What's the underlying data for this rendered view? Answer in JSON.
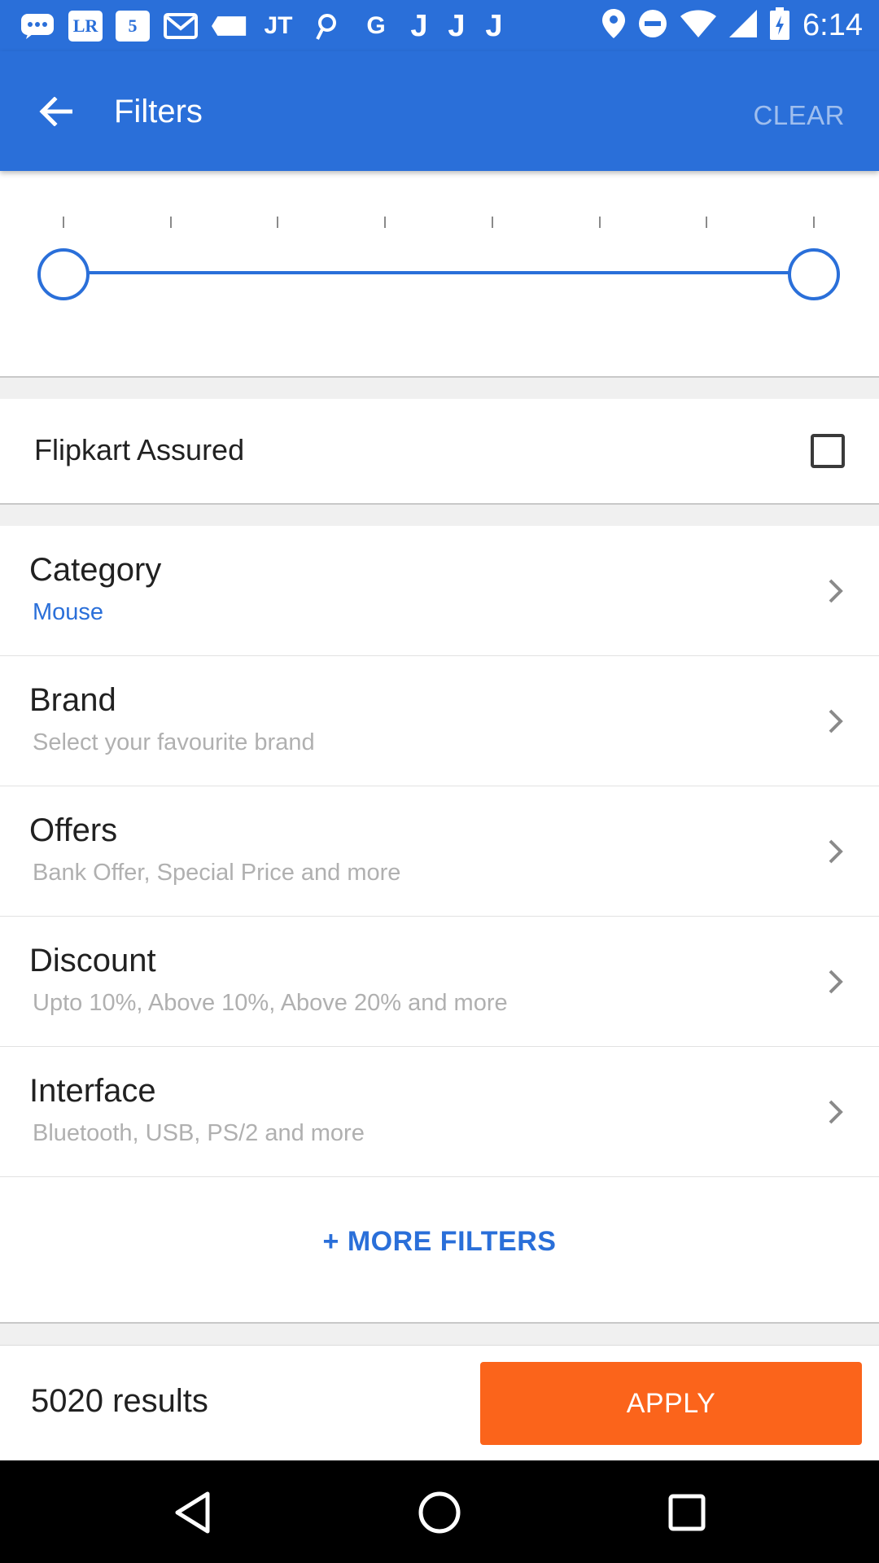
{
  "status_bar": {
    "time": "6:14",
    "notification_icons": [
      {
        "name": "chat-bubble-icon",
        "glyph": "…"
      },
      {
        "name": "lr-app-icon",
        "glyph": "LR"
      },
      {
        "name": "five-app-icon",
        "glyph": "5"
      },
      {
        "name": "gmail-icon",
        "glyph": "M"
      },
      {
        "name": "tag-icon",
        "glyph": ""
      },
      {
        "name": "jt-app-icon",
        "glyph": "JT"
      },
      {
        "name": "link-app-icon",
        "glyph": "☉"
      },
      {
        "name": "google-icon",
        "glyph": "G"
      },
      {
        "name": "j-app-icon-1",
        "glyph": "J"
      },
      {
        "name": "j-app-icon-2",
        "glyph": "J"
      },
      {
        "name": "j-app-icon-3",
        "glyph": "J"
      }
    ]
  },
  "app_bar": {
    "title": "Filters",
    "clear_label": "CLEAR"
  },
  "price_slider": {
    "tick_count": 8,
    "range_min_fraction": 0.0,
    "range_max_fraction": 1.0
  },
  "assured": {
    "label": "Flipkart Assured",
    "checked": false
  },
  "filters": [
    {
      "title": "Category",
      "subtitle": "Mouse",
      "accent": true
    },
    {
      "title": "Brand",
      "subtitle": "Select your favourite brand",
      "accent": false
    },
    {
      "title": "Offers",
      "subtitle": "Bank Offer, Special Price and more",
      "accent": false
    },
    {
      "title": "Discount",
      "subtitle": "Upto 10%, Above 10%, Above 20% and more",
      "accent": false
    },
    {
      "title": "Interface",
      "subtitle": "Bluetooth, USB, PS/2 and more",
      "accent": false
    }
  ],
  "more_filters_label": "+ MORE FILTERS",
  "footer": {
    "results": "5020 results",
    "apply_label": "APPLY"
  },
  "colors": {
    "primary": "#2a6fd9",
    "apply": "#fb641b"
  }
}
